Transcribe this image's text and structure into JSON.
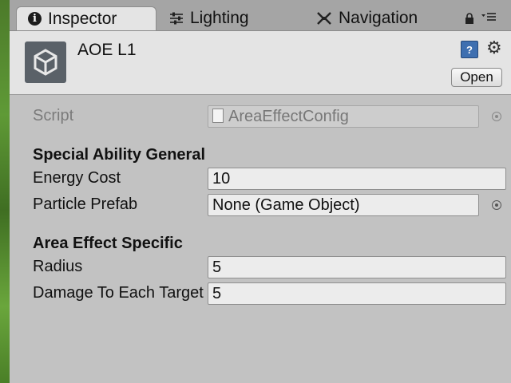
{
  "tabs": [
    {
      "label": "Inspector",
      "icon": "info-icon"
    },
    {
      "label": "Lighting",
      "icon": "sliders-icon"
    },
    {
      "label": "Navigation",
      "icon": "navigation-icon"
    }
  ],
  "header": {
    "title": "AOE L1",
    "open_label": "Open"
  },
  "properties": {
    "script": {
      "label": "Script",
      "value": "AreaEffectConfig"
    },
    "sections": [
      {
        "title": "Special Ability General",
        "fields": [
          {
            "label": "Energy Cost",
            "value": "10"
          },
          {
            "label": "Particle Prefab",
            "value": "None (Game Object)"
          }
        ]
      },
      {
        "title": "Area Effect Specific",
        "fields": [
          {
            "label": "Radius",
            "value": "5"
          },
          {
            "label": "Damage To Each Target",
            "value": "5"
          }
        ]
      }
    ]
  },
  "colors": {
    "panel_bg": "#c2c2c2",
    "header_bg": "#e4e4e4",
    "tabbar_bg": "#a5a5a5"
  }
}
